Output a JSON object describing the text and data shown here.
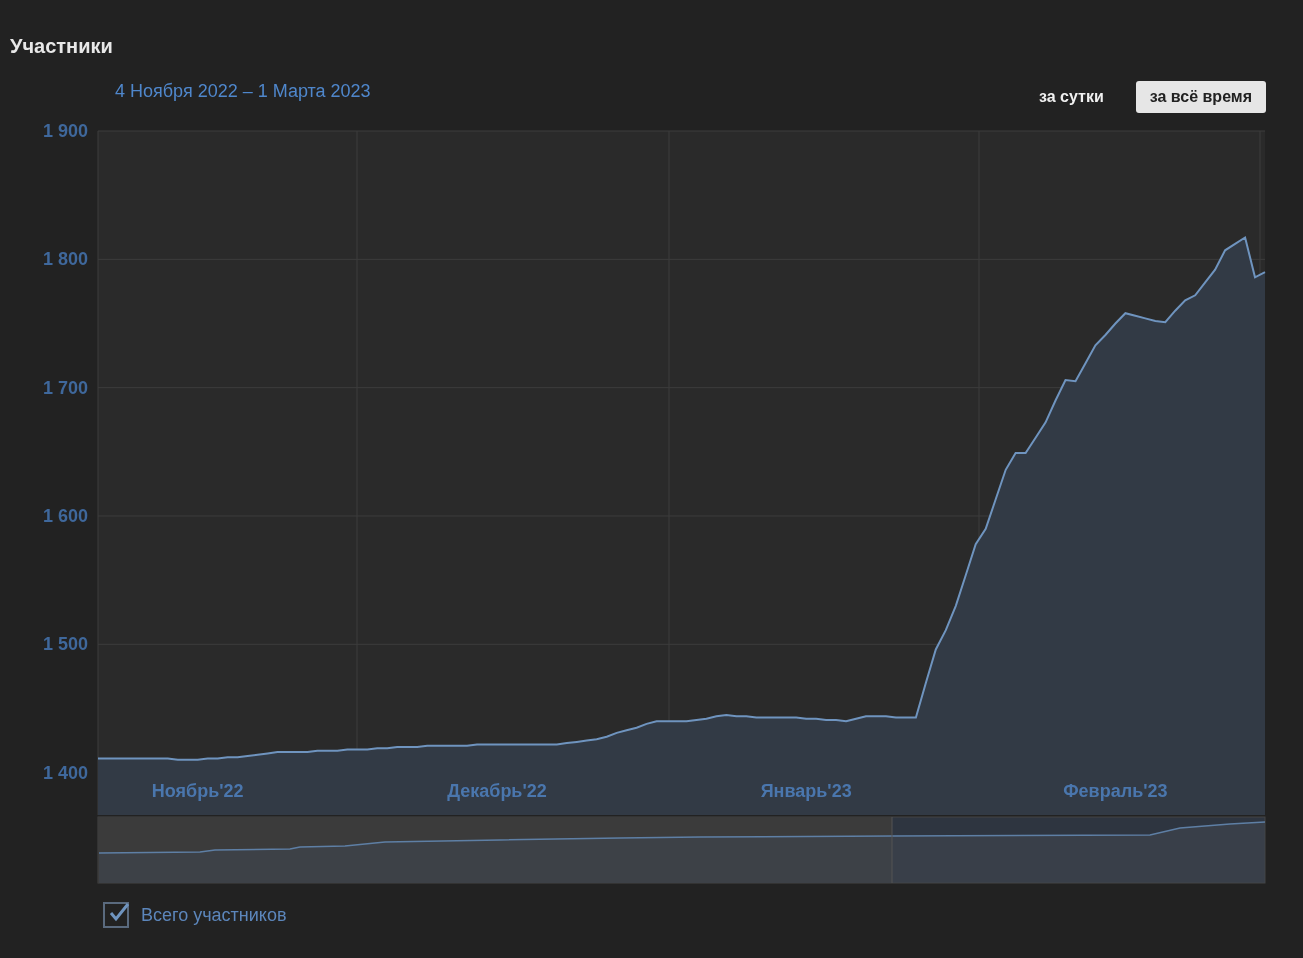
{
  "title": "Участники",
  "date_range": "4 Ноября 2022 – 1 Марта 2023",
  "periods": [
    {
      "label": "за сутки",
      "selected": false
    },
    {
      "label": "за всё время",
      "selected": true
    }
  ],
  "chart_data": {
    "type": "area",
    "categories": [
      null,
      null,
      null,
      null,
      null,
      null,
      null,
      null,
      null,
      null,
      "Ноябрь'22",
      null,
      null,
      null,
      null,
      null,
      null,
      null,
      null,
      null,
      null,
      null,
      null,
      null,
      null,
      null,
      null,
      null,
      null,
      null,
      null,
      null,
      null,
      null,
      null,
      null,
      null,
      null,
      null,
      null,
      "Декабрь'22",
      null,
      null,
      null,
      null,
      null,
      null,
      null,
      null,
      null,
      null,
      null,
      null,
      null,
      null,
      null,
      null,
      null,
      null,
      null,
      null,
      null,
      null,
      null,
      null,
      null,
      null,
      null,
      null,
      null,
      null,
      "Январь'23",
      null,
      null,
      null,
      null,
      null,
      null,
      null,
      null,
      null,
      null,
      null,
      null,
      null,
      null,
      null,
      null,
      null,
      null,
      null,
      null,
      null,
      null,
      null,
      null,
      null,
      null,
      null,
      null,
      null,
      null,
      "Февраль'23",
      null,
      null,
      null,
      null,
      null,
      null,
      null,
      null,
      null,
      null,
      null,
      null,
      null,
      null,
      null
    ],
    "series": [
      {
        "name": "Всего участников",
        "color": "#6f94bf",
        "values": [
          1411,
          1411,
          1411,
          1411,
          1411,
          1411,
          1411,
          1411,
          1410,
          1410,
          1410,
          1411,
          1411,
          1412,
          1412,
          1413,
          1414,
          1415,
          1416,
          1416,
          1416,
          1416,
          1417,
          1417,
          1417,
          1418,
          1418,
          1418,
          1419,
          1419,
          1420,
          1420,
          1420,
          1421,
          1421,
          1421,
          1421,
          1421,
          1422,
          1422,
          1422,
          1422,
          1422,
          1422,
          1422,
          1422,
          1422,
          1423,
          1424,
          1425,
          1426,
          1428,
          1431,
          1433,
          1435,
          1438,
          1440,
          1440,
          1440,
          1440,
          1441,
          1442,
          1444,
          1445,
          1444,
          1444,
          1443,
          1443,
          1443,
          1443,
          1443,
          1442,
          1442,
          1441,
          1441,
          1440,
          1442,
          1444,
          1444,
          1444,
          1443,
          1443,
          1443,
          1470,
          1496,
          1511,
          1530,
          1554,
          1578,
          1590,
          1613,
          1636,
          1649,
          1649,
          1661,
          1673,
          1690,
          1706,
          1705,
          1719,
          1733,
          1741,
          1750,
          1758,
          1756,
          1754,
          1752,
          1751,
          1760,
          1768,
          1772,
          1782,
          1792,
          1807,
          1812,
          1817,
          1786,
          1790
        ]
      }
    ],
    "grid": true,
    "ylim": [
      1367,
      1900
    ],
    "yticks": [
      {
        "value": 1400,
        "label": "1 400"
      },
      {
        "value": 1500,
        "label": "1 500"
      },
      {
        "value": 1600,
        "label": "1 600"
      },
      {
        "value": 1700,
        "label": "1 700"
      },
      {
        "value": 1800,
        "label": "1 800"
      },
      {
        "value": 1900,
        "label": "1 900"
      }
    ]
  },
  "legend": [
    {
      "checked": true
    }
  ]
}
